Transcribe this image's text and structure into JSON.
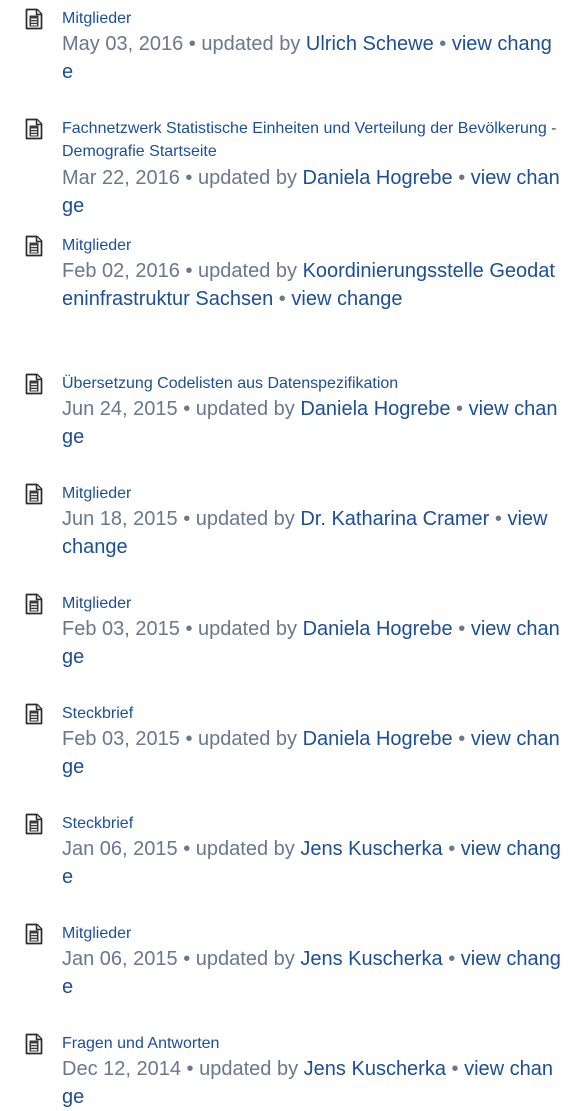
{
  "labels": {
    "updated_by": "updated by",
    "separator": "•",
    "view_change": "view change"
  },
  "icon": "page-document-icon",
  "colors": {
    "link": "#1c4f96",
    "meta": "#6b778c"
  },
  "entries": [
    {
      "title": "Mitglieder",
      "date": "May 03, 2016",
      "author": "Ulrich Schewe"
    },
    {
      "title": "Fachnetzwerk Statistische Einheiten und Verteilung der Bevölkerung - Demografie Startseite",
      "date": "Mar 22, 2016",
      "author": "Daniela Hogrebe"
    },
    {
      "title": "Mitglieder",
      "date": "Feb 02, 2016",
      "author": "Koordinierungsstelle Geodateninfrastruktur Sachsen"
    },
    {
      "title": "Übersetzung Codelisten aus Datenspezifikation",
      "date": "Jun 24, 2015",
      "author": "Daniela Hogrebe"
    },
    {
      "title": "Mitglieder",
      "date": "Jun 18, 2015",
      "author": "Dr. Katharina Cramer"
    },
    {
      "title": "Mitglieder",
      "date": "Feb 03, 2015",
      "author": "Daniela Hogrebe"
    },
    {
      "title": "Steckbrief",
      "date": "Feb 03, 2015",
      "author": "Daniela Hogrebe"
    },
    {
      "title": "Steckbrief",
      "date": "Jan 06, 2015",
      "author": "Jens Kuscherka"
    },
    {
      "title": "Mitglieder",
      "date": "Jan 06, 2015",
      "author": "Jens Kuscherka"
    },
    {
      "title": "Fragen und Antworten",
      "date": "Dec 12, 2014",
      "author": "Jens Kuscherka"
    }
  ]
}
